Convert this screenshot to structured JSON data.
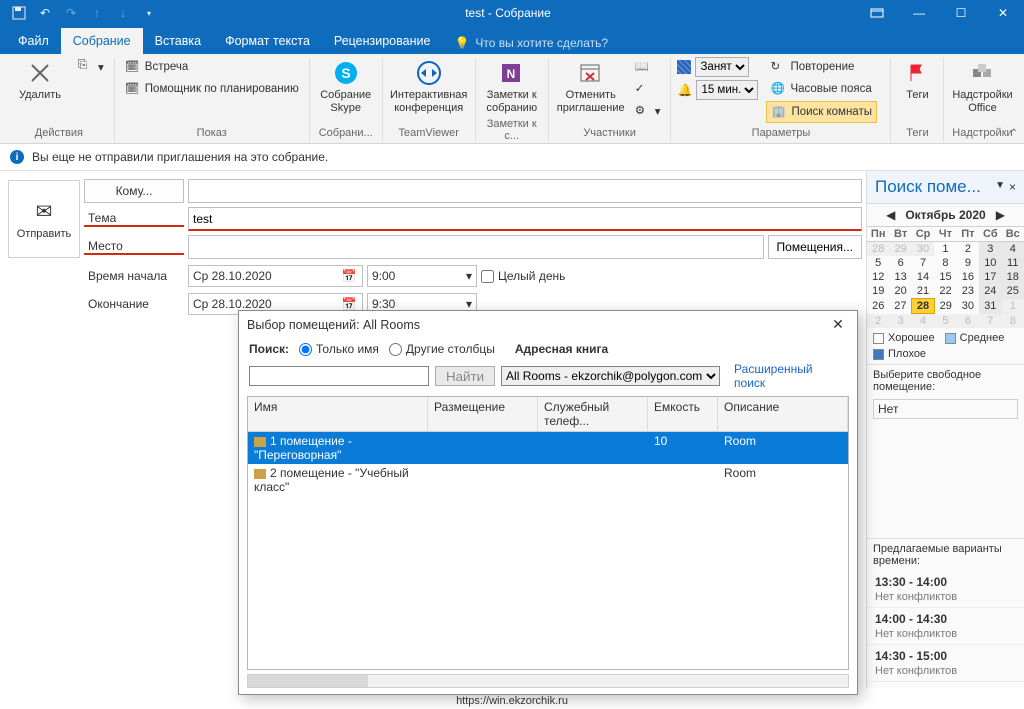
{
  "title": "test - Собрание",
  "tabs": {
    "file": "Файл",
    "meeting": "Собрание",
    "insert": "Вставка",
    "format": "Формат текста",
    "review": "Рецензирование"
  },
  "tell_me": "Что вы хотите сделать?",
  "ribbon": {
    "actions": {
      "delete": "Удалить",
      "label": "Действия"
    },
    "show": {
      "appointment": "Встреча",
      "scheduling": "Помощник по планированию",
      "label": "Показ"
    },
    "skype": {
      "btn": "Собрание Skype",
      "label": "Собрание...",
      "label2": "Собрани..."
    },
    "tv": {
      "btn": "Интерактивная\nконференция",
      "label": "TeamViewer"
    },
    "onenote": {
      "btn": "Заметки к собранию",
      "label": "Заметки к с..."
    },
    "participants": {
      "cancel": "Отменить приглашение",
      "label": "Участники"
    },
    "params": {
      "busy": "Занят",
      "reminder": "15 мин.",
      "recurrence": "Повторение",
      "timezones": "Часовые пояса",
      "roomfinder": "Поиск комнаты",
      "label": "Параметры"
    },
    "tags": {
      "btn": "Теги",
      "label": "Теги"
    },
    "addins": {
      "btn": "Надстройки Office",
      "label": "Надстройки"
    }
  },
  "infobar": "Вы еще не отправили приглашения на это собрание.",
  "compose": {
    "send": "Отправить",
    "to": "Кому...",
    "subject_lbl": "Тема",
    "subject_val": "test",
    "location_lbl": "Место",
    "rooms_btn": "Помещения...",
    "start_lbl": "Время начала",
    "end_lbl": "Окончание",
    "start_date": "Ср 28.10.2020",
    "end_date": "Ср 28.10.2020",
    "start_time": "9:00",
    "end_time": "9:30",
    "allday": "Целый день"
  },
  "roomfinder": {
    "title": "Поиск поме...",
    "month": "Октябрь 2020",
    "dow": [
      "Пн",
      "Вт",
      "Ср",
      "Чт",
      "Пт",
      "Сб",
      "Вс"
    ],
    "weeks": [
      [
        {
          "d": "28",
          "dim": true
        },
        {
          "d": "29",
          "dim": true
        },
        {
          "d": "30",
          "dim": true
        },
        {
          "d": "1"
        },
        {
          "d": "2"
        },
        {
          "d": "3",
          "shade": true
        },
        {
          "d": "4",
          "shade": true
        }
      ],
      [
        {
          "d": "5"
        },
        {
          "d": "6"
        },
        {
          "d": "7"
        },
        {
          "d": "8"
        },
        {
          "d": "9"
        },
        {
          "d": "10",
          "shade": true
        },
        {
          "d": "11",
          "shade": true
        }
      ],
      [
        {
          "d": "12"
        },
        {
          "d": "13"
        },
        {
          "d": "14"
        },
        {
          "d": "15"
        },
        {
          "d": "16"
        },
        {
          "d": "17",
          "shade": true
        },
        {
          "d": "18",
          "shade": true
        }
      ],
      [
        {
          "d": "19"
        },
        {
          "d": "20"
        },
        {
          "d": "21"
        },
        {
          "d": "22"
        },
        {
          "d": "23"
        },
        {
          "d": "24",
          "shade": true
        },
        {
          "d": "25",
          "shade": true
        }
      ],
      [
        {
          "d": "26"
        },
        {
          "d": "27"
        },
        {
          "d": "28",
          "today": true
        },
        {
          "d": "29"
        },
        {
          "d": "30"
        },
        {
          "d": "31",
          "shade": true
        },
        {
          "d": "1",
          "dim": true
        }
      ],
      [
        {
          "d": "2",
          "dim": true
        },
        {
          "d": "3",
          "dim": true
        },
        {
          "d": "4",
          "dim": true
        },
        {
          "d": "5",
          "dim": true
        },
        {
          "d": "6",
          "dim": true
        },
        {
          "d": "7",
          "dim": true
        },
        {
          "d": "8",
          "dim": true
        }
      ]
    ],
    "legend": {
      "good": "Хорошее",
      "fair": "Среднее",
      "bad": "Плохое"
    },
    "choose": "Выберите свободное помещение:",
    "none": "Нет",
    "sugg_hdr": "Предлагаемые варианты времени:",
    "suggestions": [
      {
        "time": "13:30 - 14:00",
        "note": "Нет конфликтов"
      },
      {
        "time": "14:00 - 14:30",
        "note": "Нет конфликтов"
      },
      {
        "time": "14:30 - 15:00",
        "note": "Нет конфликтов"
      }
    ]
  },
  "modal": {
    "title": "Выбор помещений: All Rooms",
    "search_lbl": "Поиск:",
    "name_only": "Только имя",
    "other_cols": "Другие столбцы",
    "addrbook": "Адресная книга",
    "find": "Найти",
    "source": "All Rooms - ekzorchik@polygon.com",
    "adv": "Расширенный поиск",
    "cols": {
      "name": "Имя",
      "loc": "Размещение",
      "phone": "Служебный телеф...",
      "cap": "Емкость",
      "desc": "Описание"
    },
    "rows": [
      {
        "name": "1 помещение - \"Переговорная\"",
        "cap": "10",
        "desc": "Room",
        "sel": true
      },
      {
        "name": "2 помещение - \"Учебный класс\"",
        "cap": "",
        "desc": "Room",
        "sel": false
      }
    ]
  },
  "footer": "https://win.ekzorchik.ru"
}
